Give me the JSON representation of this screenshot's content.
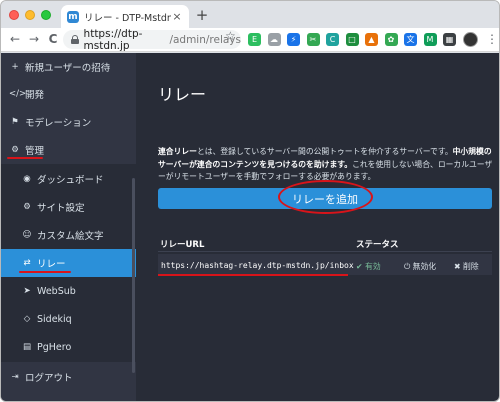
{
  "browser": {
    "tab_title": "リレー - DTP-Mstdn.jp",
    "tab_favicon": "m",
    "close_glyph": "×",
    "new_tab_glyph": "+",
    "url_host": "https://dtp-mstdn.jp",
    "url_path": "/admin/relays",
    "back_glyph": "←",
    "forward_glyph": "→",
    "reload_glyph": "C",
    "star_glyph": "☆",
    "menu_glyph": "⋮",
    "extensions": [
      {
        "name": "evernote-extension-icon",
        "color": "#2dbe60",
        "glyph": "E"
      },
      {
        "name": "cloud-extension-icon",
        "color": "#9aa0a6",
        "glyph": "☁"
      },
      {
        "name": "bolt-extension-icon",
        "color": "#1a73e8",
        "glyph": "⚡"
      },
      {
        "name": "tool-extension-icon",
        "color": "#34a853",
        "glyph": "✂"
      },
      {
        "name": "c-extension-icon",
        "color": "#20a39e",
        "glyph": "C"
      },
      {
        "name": "box-extension-icon",
        "color": "#1e8e3e",
        "glyph": "□"
      },
      {
        "name": "rocket-extension-icon",
        "color": "#e8710a",
        "glyph": "▲"
      },
      {
        "name": "leaf-extension-icon",
        "color": "#34a853",
        "glyph": "✿"
      },
      {
        "name": "translate-extension-icon",
        "color": "#1a73e8",
        "glyph": "文"
      },
      {
        "name": "m-extension-icon",
        "color": "#0f9d58",
        "glyph": "M"
      },
      {
        "name": "grid-extension-icon",
        "color": "#3c4043",
        "glyph": "▦"
      }
    ]
  },
  "sidebar": {
    "items": [
      {
        "label": "新規ユーザーの招待",
        "icon": "user-plus-icon",
        "glyph": "+"
      },
      {
        "label": "開発",
        "icon": "code-icon",
        "glyph": "</>"
      },
      {
        "label": "モデレーション",
        "icon": "flag-icon",
        "glyph": "⚑"
      },
      {
        "label": "管理",
        "icon": "cogs-icon",
        "glyph": "⚙"
      },
      {
        "label": "ダッシュボード",
        "icon": "dashboard-icon",
        "glyph": "◉"
      },
      {
        "label": "サイト設定",
        "icon": "cog-icon",
        "glyph": "⚙"
      },
      {
        "label": "カスタム絵文字",
        "icon": "smile-icon",
        "glyph": "☺"
      },
      {
        "label": "リレー",
        "icon": "exchange-icon",
        "glyph": "⇄"
      },
      {
        "label": "WebSub",
        "icon": "paper-plane-icon",
        "glyph": "➤"
      },
      {
        "label": "Sidekiq",
        "icon": "diamond-icon",
        "glyph": "◇"
      },
      {
        "label": "PgHero",
        "icon": "database-icon",
        "glyph": "▤"
      },
      {
        "label": "ログアウト",
        "icon": "sign-out-icon",
        "glyph": "⇥"
      }
    ]
  },
  "main": {
    "title": "リレー",
    "desc_bold1": "連合リレー",
    "desc_text1": "とは、登録しているサーバー間の公開トゥートを仲介するサーバーです。",
    "desc_bold2": "中小規模のサーバーが連合のコンテンツを見つけるのを助けます。",
    "desc_text2": "これを使用しない場合、ローカルユーザーがリモートユーザーを手動でフォローする必要があります。",
    "add_button": "リレーを追加",
    "table": {
      "headers": [
        "リレーURL",
        "ステータス"
      ],
      "rows": [
        {
          "url": "https://hashtag-relay.dtp-mstdn.jp/inbox",
          "status": "有効",
          "disable": "無効化",
          "delete": "削除"
        }
      ]
    },
    "check_glyph": "✔",
    "power_glyph": "⏻",
    "delete_glyph": "✖"
  },
  "colors": {
    "accent": "#2b90d9",
    "annotation": "#d8141a",
    "status_ok": "#79bd9a"
  }
}
